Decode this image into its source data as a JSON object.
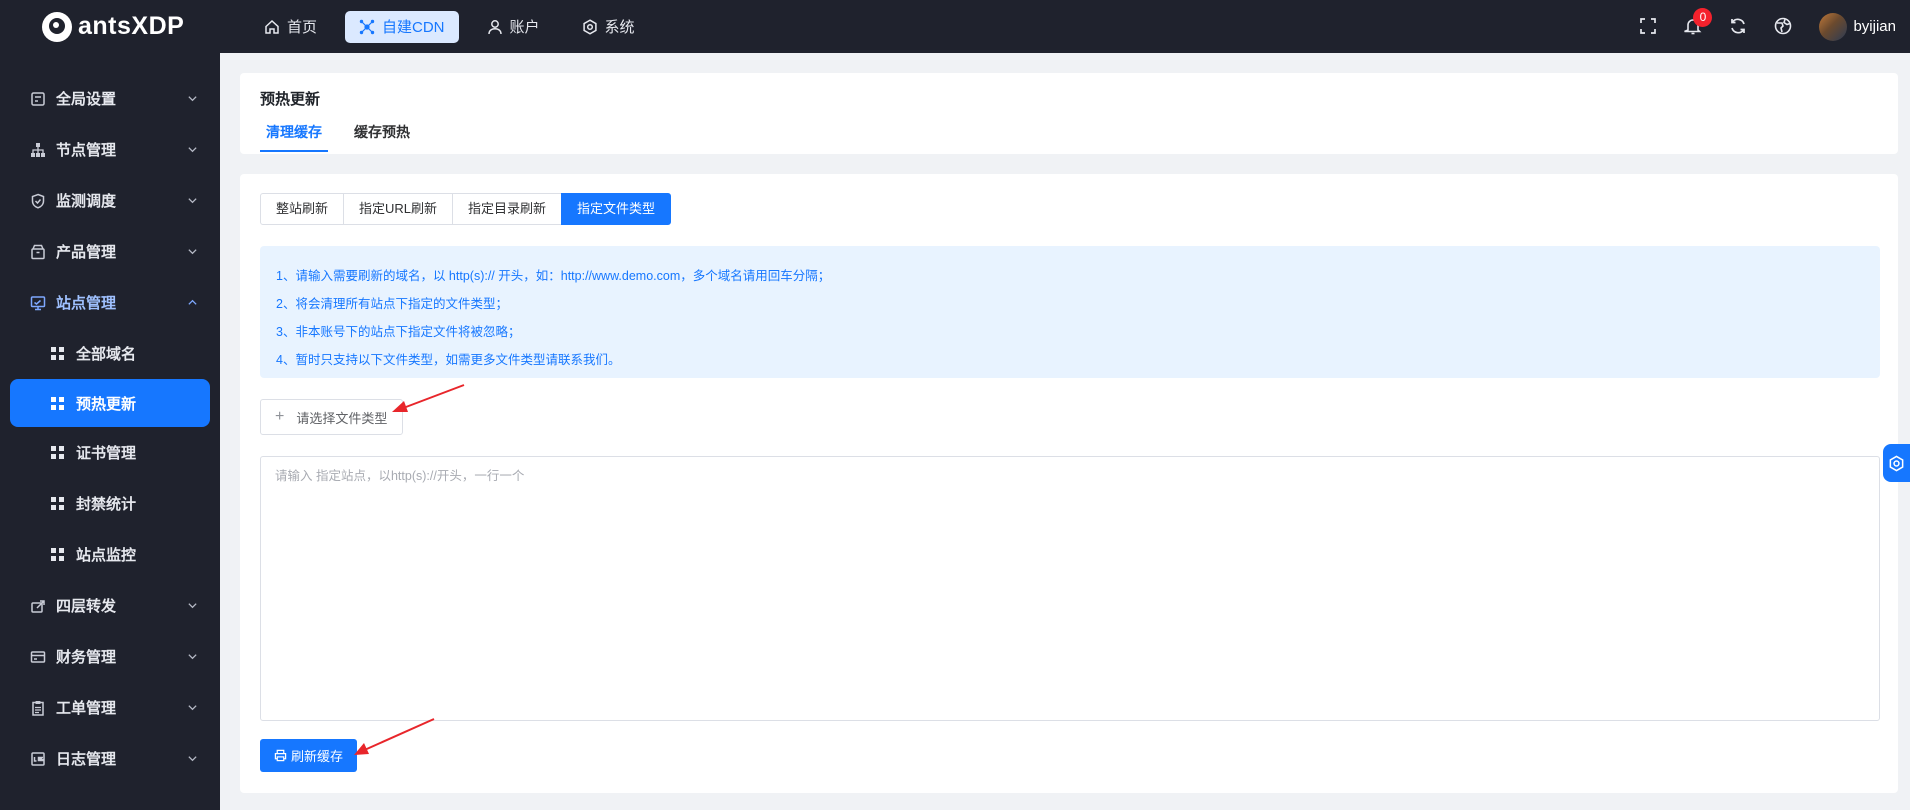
{
  "app": {
    "name": "antsXDP"
  },
  "topnav": [
    {
      "label": "首页",
      "icon": "home-icon",
      "active": false
    },
    {
      "label": "自建CDN",
      "icon": "cdn-icon",
      "active": true
    },
    {
      "label": "账户",
      "icon": "user-icon",
      "active": false
    },
    {
      "label": "系统",
      "icon": "gear-icon",
      "active": false
    }
  ],
  "header_tools": {
    "notifications_count": "0",
    "username": "byijian"
  },
  "sidebar": {
    "groups": [
      {
        "label": "全局设置",
        "icon": "settings-panel-icon",
        "expanded": false
      },
      {
        "label": "节点管理",
        "icon": "hierarchy-icon",
        "expanded": false
      },
      {
        "label": "监测调度",
        "icon": "shield-icon",
        "expanded": false
      },
      {
        "label": "产品管理",
        "icon": "box-icon",
        "expanded": false
      },
      {
        "label": "站点管理",
        "icon": "monitor-icon",
        "expanded": true
      }
    ],
    "sub_items": [
      {
        "label": "全部域名",
        "active": false
      },
      {
        "label": "预热更新",
        "active": true
      },
      {
        "label": "证书管理",
        "active": false
      },
      {
        "label": "封禁统计",
        "active": false
      },
      {
        "label": "站点监控",
        "active": false
      }
    ],
    "groups_after": [
      {
        "label": "四层转发",
        "icon": "forward-icon"
      },
      {
        "label": "财务管理",
        "icon": "wallet-icon"
      },
      {
        "label": "工单管理",
        "icon": "clipboard-icon"
      },
      {
        "label": "日志管理",
        "icon": "log-icon"
      }
    ]
  },
  "page": {
    "title": "预热更新",
    "tabs": [
      {
        "label": "清理缓存",
        "active": true
      },
      {
        "label": "缓存预热",
        "active": false
      }
    ],
    "refresh_modes": [
      {
        "label": "整站刷新",
        "active": false
      },
      {
        "label": "指定URL刷新",
        "active": false
      },
      {
        "label": "指定目录刷新",
        "active": false
      },
      {
        "label": "指定文件类型",
        "active": true
      }
    ],
    "notice_lines": [
      "1、请输入需要刷新的域名，以 http(s):// 开头，如：http://www.demo.com，多个域名请用回车分隔；",
      "2、将会清理所有站点下指定的文件类型；",
      "3、非本账号下的站点下指定文件将被忽略；",
      "4、暂时只支持以下文件类型，如需更多文件类型请联系我们。"
    ],
    "file_type_select": {
      "label": "请选择文件类型"
    },
    "sites_input": {
      "placeholder": "请输入 指定站点，以http(s)://开头，一行一个",
      "value": ""
    },
    "submit_label": "刷新缓存"
  }
}
